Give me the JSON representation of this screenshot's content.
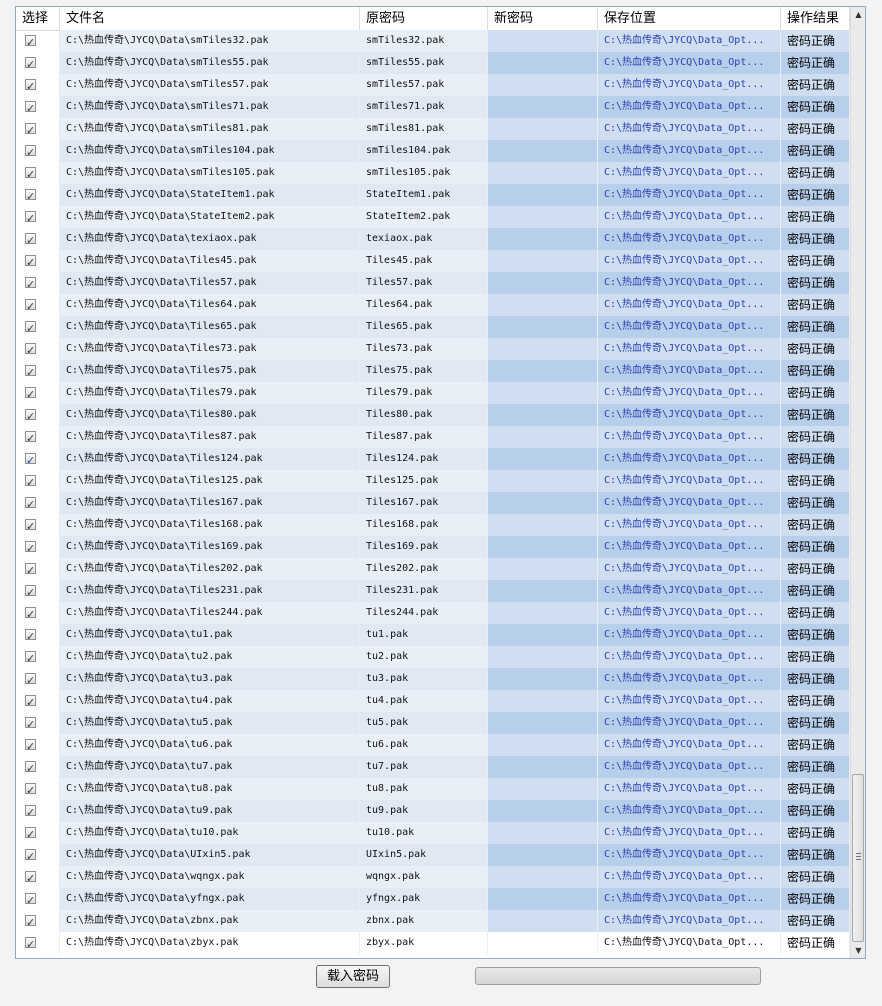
{
  "columns": [
    "选择",
    "文件名",
    "原密码",
    "新密码",
    "保存位置",
    "操作结果"
  ],
  "rows": [
    {
      "checked": true,
      "highlight": false,
      "file": "C:\\热血传奇\\JYCQ\\Data\\smTiles32.pak",
      "orig": "smTiles32.pak",
      "new": "",
      "save": "C:\\热血传奇\\JYCQ\\Data_Opt...",
      "result": "密码正确"
    },
    {
      "checked": true,
      "highlight": false,
      "file": "C:\\热血传奇\\JYCQ\\Data\\smTiles55.pak",
      "orig": "smTiles55.pak",
      "new": "",
      "save": "C:\\热血传奇\\JYCQ\\Data_Opt...",
      "result": "密码正确"
    },
    {
      "checked": true,
      "highlight": false,
      "file": "C:\\热血传奇\\JYCQ\\Data\\smTiles57.pak",
      "orig": "smTiles57.pak",
      "new": "",
      "save": "C:\\热血传奇\\JYCQ\\Data_Opt...",
      "result": "密码正确"
    },
    {
      "checked": true,
      "highlight": false,
      "file": "C:\\热血传奇\\JYCQ\\Data\\smTiles71.pak",
      "orig": "smTiles71.pak",
      "new": "",
      "save": "C:\\热血传奇\\JYCQ\\Data_Opt...",
      "result": "密码正确"
    },
    {
      "checked": true,
      "highlight": false,
      "file": "C:\\热血传奇\\JYCQ\\Data\\smTiles81.pak",
      "orig": "smTiles81.pak",
      "new": "",
      "save": "C:\\热血传奇\\JYCQ\\Data_Opt...",
      "result": "密码正确"
    },
    {
      "checked": true,
      "highlight": false,
      "file": "C:\\热血传奇\\JYCQ\\Data\\smTiles104.pak",
      "orig": "smTiles104.pak",
      "new": "",
      "save": "C:\\热血传奇\\JYCQ\\Data_Opt...",
      "result": "密码正确"
    },
    {
      "checked": true,
      "highlight": false,
      "file": "C:\\热血传奇\\JYCQ\\Data\\smTiles105.pak",
      "orig": "smTiles105.pak",
      "new": "",
      "save": "C:\\热血传奇\\JYCQ\\Data_Opt...",
      "result": "密码正确"
    },
    {
      "checked": true,
      "highlight": false,
      "file": "C:\\热血传奇\\JYCQ\\Data\\StateItem1.pak",
      "orig": "StateItem1.pak",
      "new": "",
      "save": "C:\\热血传奇\\JYCQ\\Data_Opt...",
      "result": "密码正确"
    },
    {
      "checked": true,
      "highlight": false,
      "file": "C:\\热血传奇\\JYCQ\\Data\\StateItem2.pak",
      "orig": "StateItem2.pak",
      "new": "",
      "save": "C:\\热血传奇\\JYCQ\\Data_Opt...",
      "result": "密码正确"
    },
    {
      "checked": true,
      "highlight": false,
      "file": "C:\\热血传奇\\JYCQ\\Data\\texiaox.pak",
      "orig": "texiaox.pak",
      "new": "",
      "save": "C:\\热血传奇\\JYCQ\\Data_Opt...",
      "result": "密码正确"
    },
    {
      "checked": true,
      "highlight": false,
      "file": "C:\\热血传奇\\JYCQ\\Data\\Tiles45.pak",
      "orig": "Tiles45.pak",
      "new": "",
      "save": "C:\\热血传奇\\JYCQ\\Data_Opt...",
      "result": "密码正确"
    },
    {
      "checked": true,
      "highlight": false,
      "file": "C:\\热血传奇\\JYCQ\\Data\\Tiles57.pak",
      "orig": "Tiles57.pak",
      "new": "",
      "save": "C:\\热血传奇\\JYCQ\\Data_Opt...",
      "result": "密码正确"
    },
    {
      "checked": true,
      "highlight": false,
      "file": "C:\\热血传奇\\JYCQ\\Data\\Tiles64.pak",
      "orig": "Tiles64.pak",
      "new": "",
      "save": "C:\\热血传奇\\JYCQ\\Data_Opt...",
      "result": "密码正确"
    },
    {
      "checked": true,
      "highlight": false,
      "file": "C:\\热血传奇\\JYCQ\\Data\\Tiles65.pak",
      "orig": "Tiles65.pak",
      "new": "",
      "save": "C:\\热血传奇\\JYCQ\\Data_Opt...",
      "result": "密码正确"
    },
    {
      "checked": true,
      "highlight": false,
      "file": "C:\\热血传奇\\JYCQ\\Data\\Tiles73.pak",
      "orig": "Tiles73.pak",
      "new": "",
      "save": "C:\\热血传奇\\JYCQ\\Data_Opt...",
      "result": "密码正确"
    },
    {
      "checked": true,
      "highlight": false,
      "file": "C:\\热血传奇\\JYCQ\\Data\\Tiles75.pak",
      "orig": "Tiles75.pak",
      "new": "",
      "save": "C:\\热血传奇\\JYCQ\\Data_Opt...",
      "result": "密码正确"
    },
    {
      "checked": true,
      "highlight": false,
      "file": "C:\\热血传奇\\JYCQ\\Data\\Tiles79.pak",
      "orig": "Tiles79.pak",
      "new": "",
      "save": "C:\\热血传奇\\JYCQ\\Data_Opt...",
      "result": "密码正确"
    },
    {
      "checked": true,
      "highlight": false,
      "file": "C:\\热血传奇\\JYCQ\\Data\\Tiles80.pak",
      "orig": "Tiles80.pak",
      "new": "",
      "save": "C:\\热血传奇\\JYCQ\\Data_Opt...",
      "result": "密码正确"
    },
    {
      "checked": true,
      "highlight": false,
      "file": "C:\\热血传奇\\JYCQ\\Data\\Tiles87.pak",
      "orig": "Tiles87.pak",
      "new": "",
      "save": "C:\\热血传奇\\JYCQ\\Data_Opt...",
      "result": "密码正确"
    },
    {
      "checked": true,
      "highlight": true,
      "file": "C:\\热血传奇\\JYCQ\\Data\\Tiles124.pak",
      "orig": "Tiles124.pak",
      "new": "",
      "save": "C:\\热血传奇\\JYCQ\\Data_Opt...",
      "result": "密码正确"
    },
    {
      "checked": true,
      "highlight": false,
      "file": "C:\\热血传奇\\JYCQ\\Data\\Tiles125.pak",
      "orig": "Tiles125.pak",
      "new": "",
      "save": "C:\\热血传奇\\JYCQ\\Data_Opt...",
      "result": "密码正确"
    },
    {
      "checked": true,
      "highlight": false,
      "file": "C:\\热血传奇\\JYCQ\\Data\\Tiles167.pak",
      "orig": "Tiles167.pak",
      "new": "",
      "save": "C:\\热血传奇\\JYCQ\\Data_Opt...",
      "result": "密码正确"
    },
    {
      "checked": true,
      "highlight": false,
      "file": "C:\\热血传奇\\JYCQ\\Data\\Tiles168.pak",
      "orig": "Tiles168.pak",
      "new": "",
      "save": "C:\\热血传奇\\JYCQ\\Data_Opt...",
      "result": "密码正确"
    },
    {
      "checked": true,
      "highlight": false,
      "file": "C:\\热血传奇\\JYCQ\\Data\\Tiles169.pak",
      "orig": "Tiles169.pak",
      "new": "",
      "save": "C:\\热血传奇\\JYCQ\\Data_Opt...",
      "result": "密码正确"
    },
    {
      "checked": true,
      "highlight": false,
      "file": "C:\\热血传奇\\JYCQ\\Data\\Tiles202.pak",
      "orig": "Tiles202.pak",
      "new": "",
      "save": "C:\\热血传奇\\JYCQ\\Data_Opt...",
      "result": "密码正确"
    },
    {
      "checked": true,
      "highlight": false,
      "file": "C:\\热血传奇\\JYCQ\\Data\\Tiles231.pak",
      "orig": "Tiles231.pak",
      "new": "",
      "save": "C:\\热血传奇\\JYCQ\\Data_Opt...",
      "result": "密码正确"
    },
    {
      "checked": true,
      "highlight": false,
      "file": "C:\\热血传奇\\JYCQ\\Data\\Tiles244.pak",
      "orig": "Tiles244.pak",
      "new": "",
      "save": "C:\\热血传奇\\JYCQ\\Data_Opt...",
      "result": "密码正确"
    },
    {
      "checked": true,
      "highlight": false,
      "file": "C:\\热血传奇\\JYCQ\\Data\\tu1.pak",
      "orig": "tu1.pak",
      "new": "",
      "save": "C:\\热血传奇\\JYCQ\\Data_Opt...",
      "result": "密码正确"
    },
    {
      "checked": true,
      "highlight": false,
      "file": "C:\\热血传奇\\JYCQ\\Data\\tu2.pak",
      "orig": "tu2.pak",
      "new": "",
      "save": "C:\\热血传奇\\JYCQ\\Data_Opt...",
      "result": "密码正确"
    },
    {
      "checked": true,
      "highlight": false,
      "file": "C:\\热血传奇\\JYCQ\\Data\\tu3.pak",
      "orig": "tu3.pak",
      "new": "",
      "save": "C:\\热血传奇\\JYCQ\\Data_Opt...",
      "result": "密码正确"
    },
    {
      "checked": true,
      "highlight": false,
      "file": "C:\\热血传奇\\JYCQ\\Data\\tu4.pak",
      "orig": "tu4.pak",
      "new": "",
      "save": "C:\\热血传奇\\JYCQ\\Data_Opt...",
      "result": "密码正确"
    },
    {
      "checked": true,
      "highlight": false,
      "file": "C:\\热血传奇\\JYCQ\\Data\\tu5.pak",
      "orig": "tu5.pak",
      "new": "",
      "save": "C:\\热血传奇\\JYCQ\\Data_Opt...",
      "result": "密码正确"
    },
    {
      "checked": true,
      "highlight": false,
      "file": "C:\\热血传奇\\JYCQ\\Data\\tu6.pak",
      "orig": "tu6.pak",
      "new": "",
      "save": "C:\\热血传奇\\JYCQ\\Data_Opt...",
      "result": "密码正确"
    },
    {
      "checked": true,
      "highlight": false,
      "file": "C:\\热血传奇\\JYCQ\\Data\\tu7.pak",
      "orig": "tu7.pak",
      "new": "",
      "save": "C:\\热血传奇\\JYCQ\\Data_Opt...",
      "result": "密码正确"
    },
    {
      "checked": true,
      "highlight": false,
      "file": "C:\\热血传奇\\JYCQ\\Data\\tu8.pak",
      "orig": "tu8.pak",
      "new": "",
      "save": "C:\\热血传奇\\JYCQ\\Data_Opt...",
      "result": "密码正确"
    },
    {
      "checked": true,
      "highlight": false,
      "file": "C:\\热血传奇\\JYCQ\\Data\\tu9.pak",
      "orig": "tu9.pak",
      "new": "",
      "save": "C:\\热血传奇\\JYCQ\\Data_Opt...",
      "result": "密码正确"
    },
    {
      "checked": true,
      "highlight": false,
      "file": "C:\\热血传奇\\JYCQ\\Data\\tu10.pak",
      "orig": "tu10.pak",
      "new": "",
      "save": "C:\\热血传奇\\JYCQ\\Data_Opt...",
      "result": "密码正确"
    },
    {
      "checked": true,
      "highlight": false,
      "file": "C:\\热血传奇\\JYCQ\\Data\\UIxin5.pak",
      "orig": "UIxin5.pak",
      "new": "",
      "save": "C:\\热血传奇\\JYCQ\\Data_Opt...",
      "result": "密码正确"
    },
    {
      "checked": true,
      "highlight": false,
      "file": "C:\\热血传奇\\JYCQ\\Data\\wqngx.pak",
      "orig": "wqngx.pak",
      "new": "",
      "save": "C:\\热血传奇\\JYCQ\\Data_Opt...",
      "result": "密码正确"
    },
    {
      "checked": true,
      "highlight": false,
      "file": "C:\\热血传奇\\JYCQ\\Data\\yfngx.pak",
      "orig": "yfngx.pak",
      "new": "",
      "save": "C:\\热血传奇\\JYCQ\\Data_Opt...",
      "result": "密码正确"
    },
    {
      "checked": true,
      "highlight": false,
      "file": "C:\\热血传奇\\JYCQ\\Data\\zbnx.pak",
      "orig": "zbnx.pak",
      "new": "",
      "save": "C:\\热血传奇\\JYCQ\\Data_Opt...",
      "result": "密码正确"
    },
    {
      "checked": true,
      "highlight": false,
      "file": "C:\\热血传奇\\JYCQ\\Data\\zbyx.pak",
      "orig": "zbyx.pak",
      "new": "",
      "save": "C:\\热血传奇\\JYCQ\\Data_Opt...",
      "result": "密码正确"
    }
  ],
  "buttons": {
    "load_password": "载入密码"
  },
  "progress": {
    "value": 0
  },
  "scrollbar": {
    "up_icon": "▲",
    "down_icon": "▼",
    "position": "bottom"
  },
  "colors": {
    "selected_cells": "#b8cfec",
    "path_text": "#2a3fb0",
    "checkmark_focused": "#1f3fb5"
  }
}
